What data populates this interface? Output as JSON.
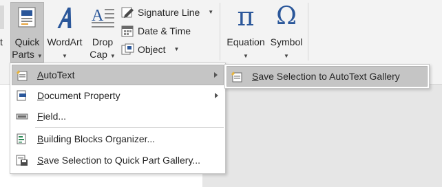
{
  "ribbon": {
    "partial_left_label": "t",
    "quick_parts": {
      "line1": "Quick",
      "line2": "Parts"
    },
    "wordart": {
      "label": "WordArt"
    },
    "drop_cap": {
      "line1": "Drop",
      "line2": "Cap"
    },
    "signature_line": {
      "label": "Signature Line"
    },
    "date_time": {
      "label": "Date & Time"
    },
    "object": {
      "label": "Object"
    },
    "equation": {
      "label": "Equation",
      "glyph": "π"
    },
    "symbol": {
      "label": "Symbol",
      "glyph": "Ω"
    }
  },
  "quick_parts_menu": {
    "items": [
      {
        "mnemonic": "A",
        "rest": "utoText",
        "has_submenu": true
      },
      {
        "mnemonic": "D",
        "rest": "ocument Property",
        "has_submenu": true
      },
      {
        "mnemonic": "F",
        "rest": "ield...",
        "has_submenu": false
      },
      {
        "mnemonic": "B",
        "rest": "uilding Blocks Organizer...",
        "has_submenu": false
      },
      {
        "mnemonic": "S",
        "rest": "ave Selection to Quick Part Gallery...",
        "has_submenu": false
      }
    ]
  },
  "autotext_submenu": {
    "items": [
      {
        "mnemonic": "S",
        "rest": "ave Selection to AutoText Gallery"
      }
    ]
  },
  "colors": {
    "accent_blue": "#2b579a",
    "highlight_gray": "#c5c5c5"
  }
}
